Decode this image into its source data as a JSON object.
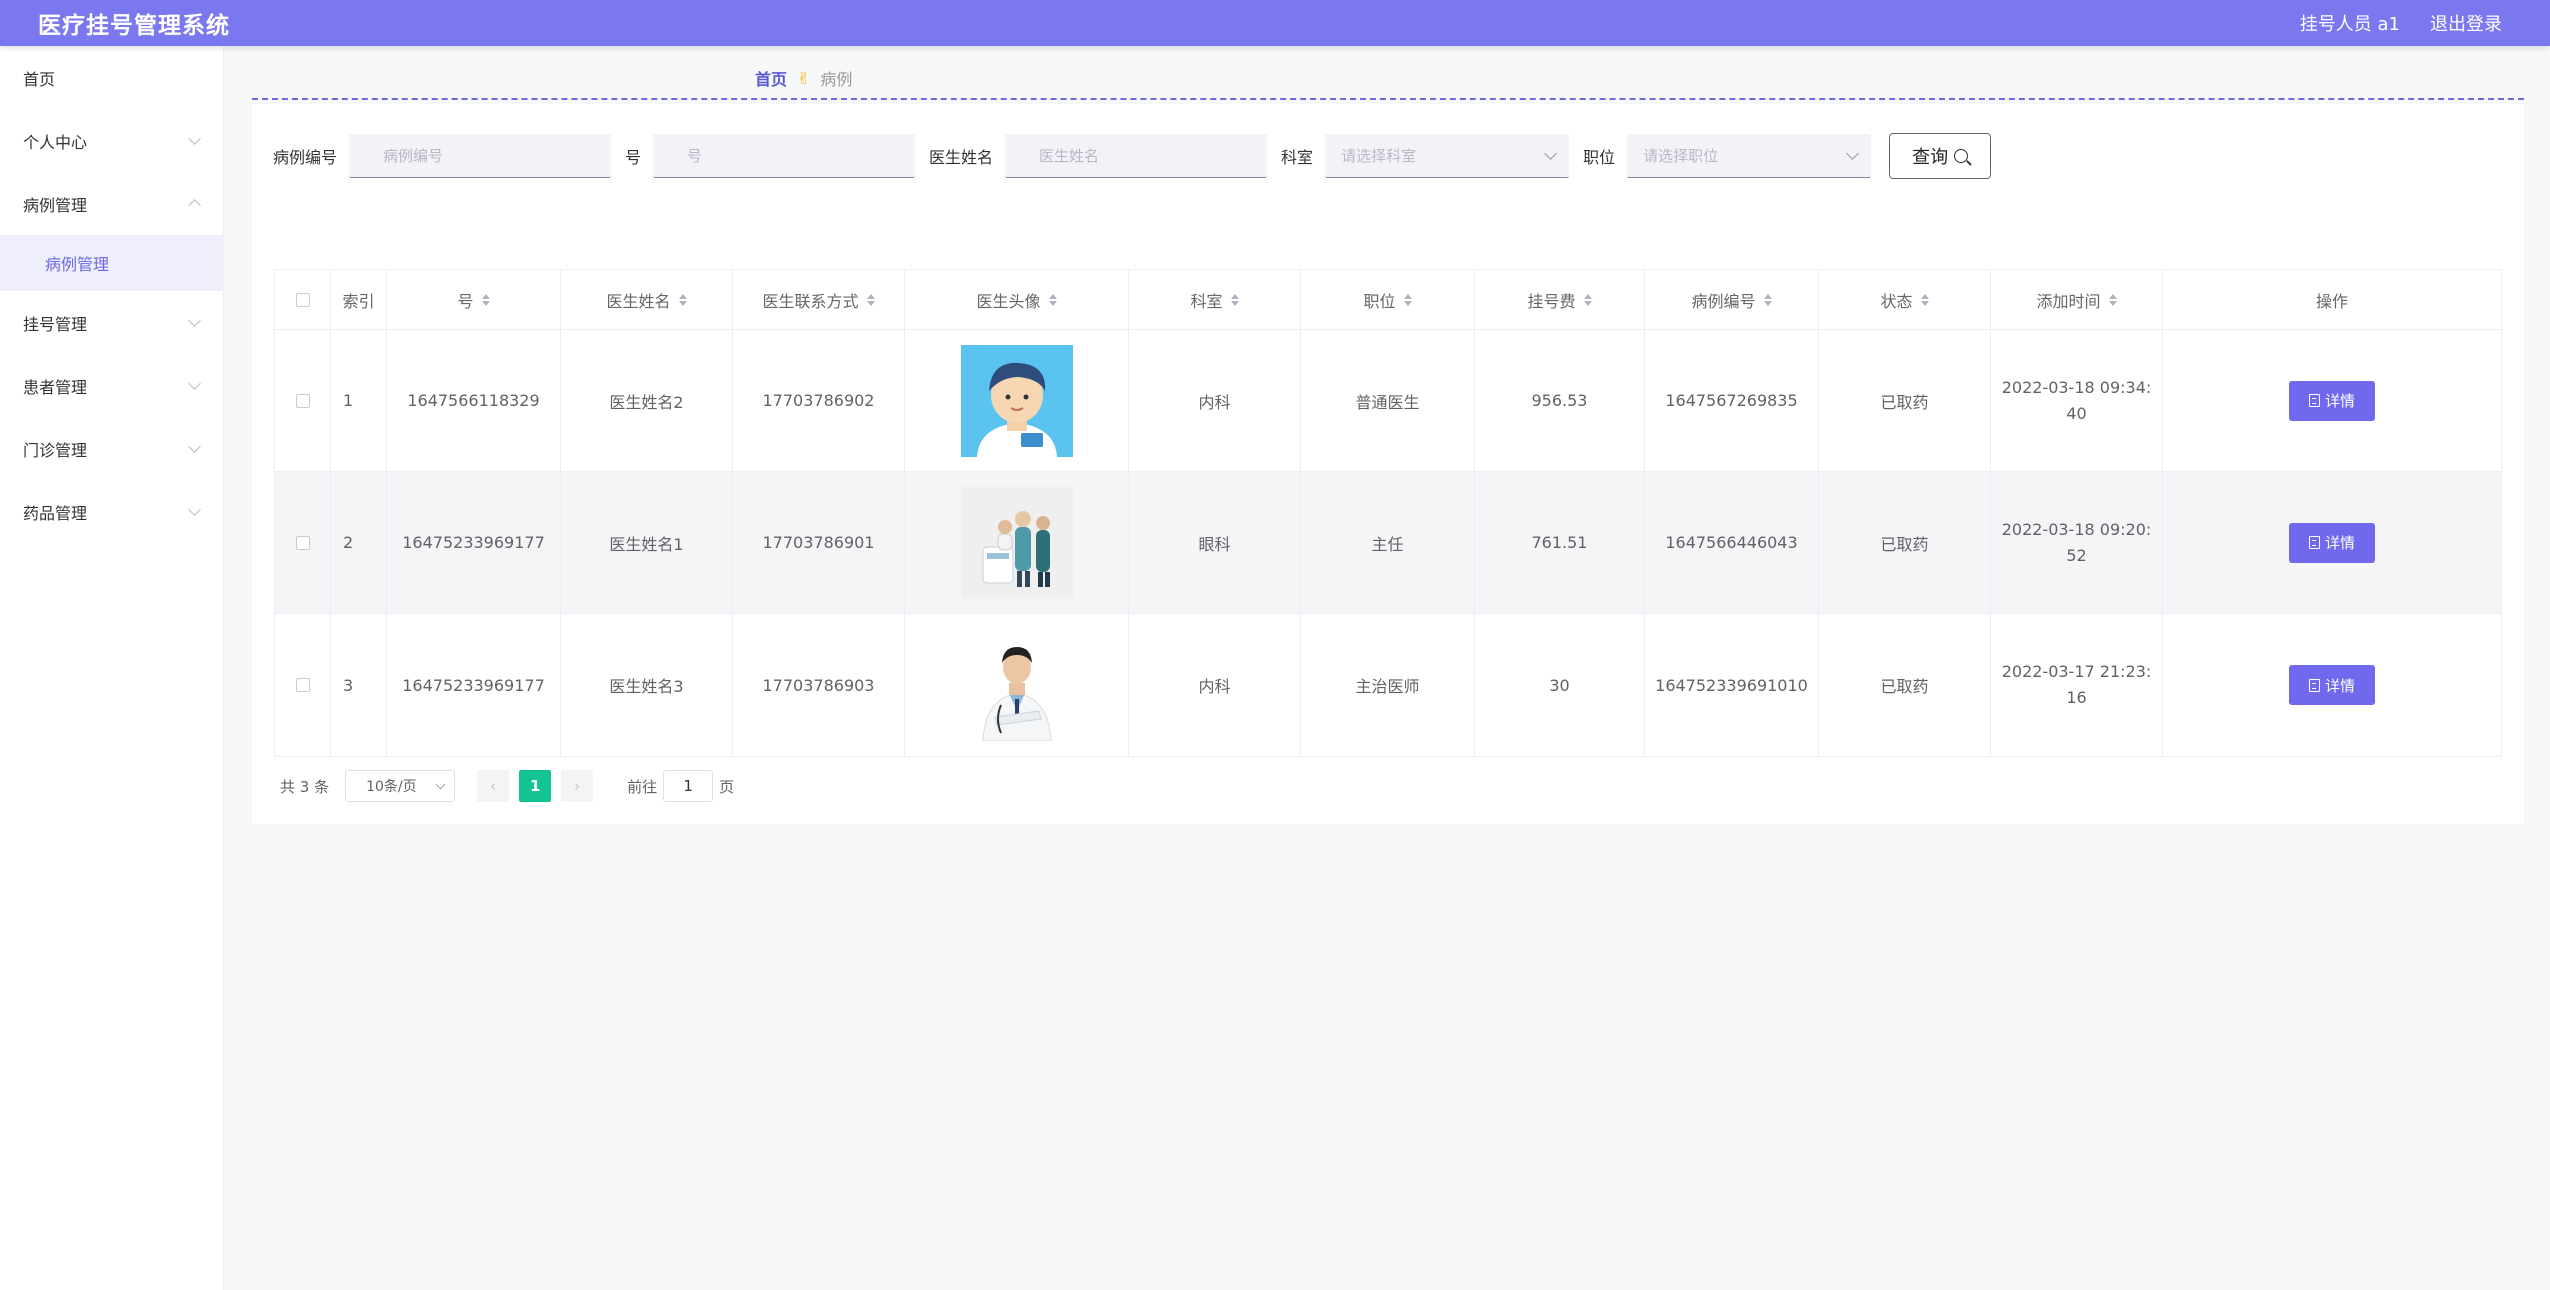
{
  "header": {
    "title": "医疗挂号管理系统",
    "user": "挂号人员 a1",
    "logout": "退出登录"
  },
  "sidebar": {
    "items": [
      {
        "label": "首页"
      },
      {
        "label": "个人中心"
      },
      {
        "label": "病例管理"
      },
      {
        "label": "病例管理"
      },
      {
        "label": "挂号管理"
      },
      {
        "label": "患者管理"
      },
      {
        "label": "门诊管理"
      },
      {
        "label": "药品管理"
      }
    ]
  },
  "breadcrumb": {
    "home": "首页",
    "separator": "✌",
    "current": "病例"
  },
  "search": {
    "case_no_label": "病例编号",
    "case_no_placeholder": "病例编号",
    "no_label": "号",
    "no_placeholder": "号",
    "doctor_label": "医生姓名",
    "doctor_placeholder": "医生姓名",
    "dept_label": "科室",
    "dept_placeholder": "请选择科室",
    "position_label": "职位",
    "position_placeholder": "请选择职位",
    "query_button": "查询"
  },
  "table": {
    "headers": [
      "索引",
      "号",
      "医生姓名",
      "医生联系方式",
      "医生头像",
      "科室",
      "职位",
      "挂号费",
      "病例编号",
      "状态",
      "添加时间",
      "操作"
    ],
    "rows": [
      {
        "index": "1",
        "no": "1647566118329",
        "doctor": "医生姓名2",
        "phone": "17703786902",
        "dept": "内科",
        "position": "普通医生",
        "fee": "956.53",
        "case_no": "1647567269835",
        "status": "已取药",
        "time": "2022-03-18 09:34:40",
        "action": "详情"
      },
      {
        "index": "2",
        "no": "16475233969177",
        "doctor": "医生姓名1",
        "phone": "17703786901",
        "dept": "眼科",
        "position": "主任",
        "fee": "761.51",
        "case_no": "1647566446043",
        "status": "已取药",
        "time": "2022-03-18 09:20:52",
        "action": "详情"
      },
      {
        "index": "3",
        "no": "16475233969177",
        "doctor": "医生姓名3",
        "phone": "17703786903",
        "dept": "内科",
        "position": "主治医师",
        "fee": "30",
        "case_no": "164752339691010",
        "status": "已取药",
        "time": "2022-03-17 21:23:16",
        "action": "详情"
      }
    ]
  },
  "pagination": {
    "total": "共 3 条",
    "page_size": "10条/页",
    "current": "1",
    "goto_label": "前往",
    "goto_value": "1",
    "page_unit": "页"
  },
  "colors": {
    "header": "#7b78ef",
    "accent": "#7069ee",
    "active_page": "#13c392"
  }
}
